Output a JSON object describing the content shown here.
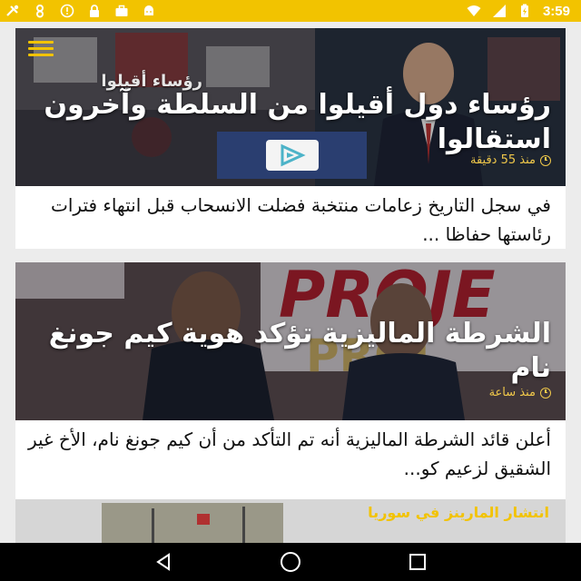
{
  "status_bar": {
    "time": "3:59",
    "icons": [
      "tools-icon",
      "contact-icon",
      "info-icon",
      "lock-icon",
      "briefcase-icon",
      "android-icon",
      "wifi-icon",
      "signal-icon",
      "battery-icon"
    ]
  },
  "articles": [
    {
      "headline": "رؤساء دول أقيلوا من السلطة وآخرون استقالوا",
      "image_label": "رؤساء أقيلوا",
      "time_ago": "منذ 55 دقيقة",
      "summary": "في سجل التاريخ زعامات منتخبة فضلت الانسحاب قبل انتهاء فترات رئاستها حفاظا ..."
    },
    {
      "headline": "الشرطة الماليزية تؤكد هوية كيم جونغ نام",
      "time_ago": "منذ ساعة",
      "summary": "أعلن قائد الشرطة الماليزية أنه تم التأكد من أن كيم جونغ نام، الأخ غير الشقيق لزعيم كو..."
    },
    {
      "headline": "انتشار المارينز في سوريا"
    }
  ],
  "colors": {
    "status_bar": "#f2c300",
    "accent": "#f0c84a",
    "nav_bar": "#000000"
  }
}
